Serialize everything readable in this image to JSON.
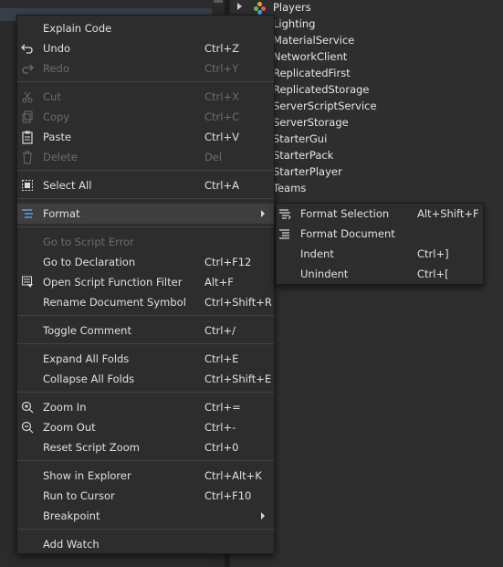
{
  "explorer": {
    "items": [
      "Players",
      "Lighting",
      "MaterialService",
      "NetworkClient",
      "ReplicatedFirst",
      "ReplicatedStorage",
      "ServerScriptService",
      "ServerStorage",
      "StarterGui",
      "StarterPack",
      "StarterPlayer",
      "Teams"
    ]
  },
  "context_menu": {
    "explain_code": "Explain Code",
    "undo": {
      "label": "Undo",
      "shortcut": "Ctrl+Z"
    },
    "redo": {
      "label": "Redo",
      "shortcut": "Ctrl+Y"
    },
    "cut": {
      "label": "Cut",
      "shortcut": "Ctrl+X"
    },
    "copy": {
      "label": "Copy",
      "shortcut": "Ctrl+C"
    },
    "paste": {
      "label": "Paste",
      "shortcut": "Ctrl+V"
    },
    "delete": {
      "label": "Delete",
      "shortcut": "Del"
    },
    "select_all": {
      "label": "Select All",
      "shortcut": "Ctrl+A"
    },
    "format": "Format",
    "go_to_script_error": "Go to Script Error",
    "go_to_declaration": {
      "label": "Go to Declaration",
      "shortcut": "Ctrl+F12"
    },
    "open_script_function_filter": {
      "label": "Open Script Function Filter",
      "shortcut": "Alt+F"
    },
    "rename_document_symbol": {
      "label": "Rename Document Symbol",
      "shortcut": "Ctrl+Shift+R"
    },
    "toggle_comment": {
      "label": "Toggle Comment",
      "shortcut": "Ctrl+/"
    },
    "expand_all_folds": {
      "label": "Expand All Folds",
      "shortcut": "Ctrl+E"
    },
    "collapse_all_folds": {
      "label": "Collapse All Folds",
      "shortcut": "Ctrl+Shift+E"
    },
    "zoom_in": {
      "label": "Zoom In",
      "shortcut": "Ctrl+="
    },
    "zoom_out": {
      "label": "Zoom Out",
      "shortcut": "Ctrl+-"
    },
    "reset_script_zoom": {
      "label": "Reset Script Zoom",
      "shortcut": "Ctrl+0"
    },
    "show_in_explorer": {
      "label": "Show in Explorer",
      "shortcut": "Ctrl+Alt+K"
    },
    "run_to_cursor": {
      "label": "Run to Cursor",
      "shortcut": "Ctrl+F10"
    },
    "breakpoint": "Breakpoint",
    "add_watch": "Add Watch"
  },
  "format_submenu": {
    "format_selection": {
      "label": "Format Selection",
      "shortcut": "Alt+Shift+F"
    },
    "format_document": {
      "label": "Format Document",
      "shortcut": ""
    },
    "indent": {
      "label": "Indent",
      "shortcut": "Ctrl+]"
    },
    "unindent": {
      "label": "Unindent",
      "shortcut": "Ctrl+["
    }
  },
  "icons": {
    "undo": "undo-icon",
    "redo": "redo-icon",
    "cut": "scissors-icon",
    "copy": "copy-icon",
    "paste": "clipboard-icon",
    "delete": "trash-icon",
    "select_all": "select-all-icon",
    "format": "format-icon",
    "filter": "filter-icon",
    "zoom_in": "zoom-in-icon",
    "zoom_out": "zoom-out-icon"
  },
  "colors": {
    "menu_bg": "#2d2d2d",
    "highlight": "#3f3f3f",
    "disabled_text": "#6c6c6c",
    "accent": "#5aa0e6"
  }
}
